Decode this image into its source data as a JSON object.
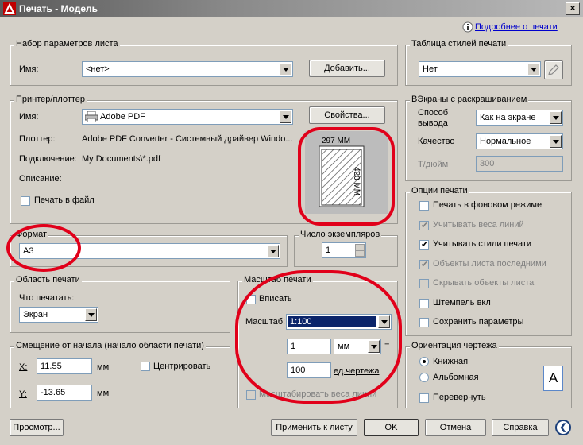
{
  "window": {
    "title": "Печать - Модель",
    "close_glyph": "×"
  },
  "help_link": "Подробнее о печати",
  "page_setup": {
    "legend": "Набор параметров листа",
    "name_label": "Имя:",
    "name_value": "<нет>",
    "add_button": "Добавить..."
  },
  "plot_style_table": {
    "legend": "Таблица стилей печати",
    "value": "Нет"
  },
  "printer": {
    "legend": "Принтер/плоттер",
    "name_label": "Имя:",
    "name_value": "Adobe PDF",
    "properties_button": "Свойства...",
    "plotter_label": "Плоттер:",
    "plotter_value": "Adobe PDF Converter - Системный драйвер Windo...",
    "connection_label": "Подключение:",
    "connection_value": "My Documents\\*.pdf",
    "description_label": "Описание:",
    "print_to_file_label": "Печать в файл",
    "print_to_file_checked": false,
    "preview_width": "297 ММ",
    "preview_height": "420 ММ"
  },
  "shaded_viewports": {
    "legend": "ВЭкраны с раскрашиванием",
    "output_label_line1": "Способ",
    "output_label_line2": "вывода",
    "output_value": "Как на экране",
    "quality_label": "Качество",
    "quality_value": "Нормальное",
    "dpi_label": "Т/дюйм",
    "dpi_value": "300"
  },
  "plot_options": {
    "legend": "Опции печати",
    "items": [
      {
        "label": "Печать в фоновом режиме",
        "checked": false,
        "disabled": false
      },
      {
        "label": "Учитывать веса линий",
        "checked": true,
        "disabled": true
      },
      {
        "label": "Учитывать стили печати",
        "checked": true,
        "disabled": false
      },
      {
        "label": "Объекты листа последними",
        "checked": true,
        "disabled": true
      },
      {
        "label": "Скрывать объекты листа",
        "checked": false,
        "disabled": true
      },
      {
        "label": "Штемпель вкл",
        "checked": false,
        "disabled": false
      },
      {
        "label": "Сохранить параметры",
        "checked": false,
        "disabled": false
      }
    ]
  },
  "paper_size": {
    "legend": "Формат",
    "value": "A3"
  },
  "copies": {
    "legend": "Число экземпляров",
    "value": "1"
  },
  "plot_area": {
    "legend": "Область печати",
    "what_label": "Что печатать:",
    "what_value": "Экран"
  },
  "plot_offset": {
    "legend": "Смещение от начала (начало области печати)",
    "x_label": "X:",
    "x_value": "11.55",
    "x_unit": "мм",
    "y_label": "Y:",
    "y_value": "-13.65",
    "y_unit": "мм",
    "center_label": "Центрировать",
    "center_checked": false
  },
  "plot_scale": {
    "legend": "Масштаб печати",
    "fit_label": "Вписать",
    "fit_checked": false,
    "scale_label": "Масштаб:",
    "scale_value": "1:100",
    "value1": "1",
    "unit_value": "мм",
    "equals": "=",
    "value2": "100",
    "drawing_units_label": "ед.чертежа",
    "scale_lineweights_label": "Масштабировать веса линий",
    "scale_lineweights_checked": false
  },
  "orientation": {
    "legend": "Ориентация чертежа",
    "portrait_label": "Книжная",
    "landscape_label": "Альбомная",
    "upside_down_label": "Перевернуть",
    "selected": "portrait",
    "icon_letter": "A"
  },
  "buttons": {
    "preview": "Просмотр...",
    "apply": "Применить к листу",
    "ok": "OK",
    "cancel": "Отмена",
    "help": "Справка",
    "collapse_glyph": "❮"
  }
}
